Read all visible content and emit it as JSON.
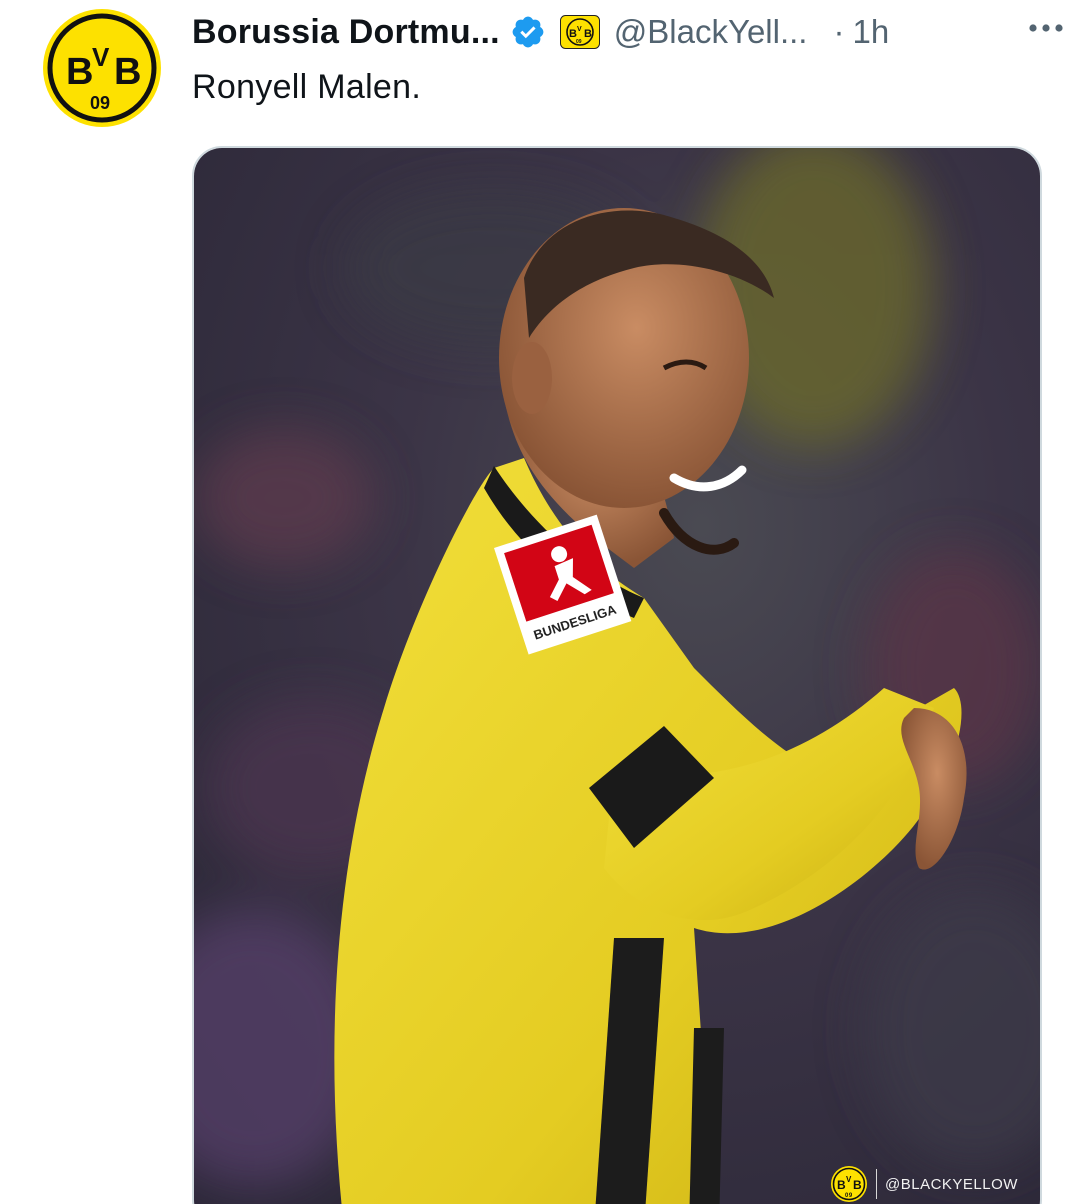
{
  "tweet": {
    "display_name": "Borussia Dortmu...",
    "handle": "@BlackYell...",
    "separator": "·",
    "time": "1h",
    "text": "Ronyell Malen."
  },
  "media": {
    "watermark": "@BLACKYELLOW",
    "patch_text": "BUNDESLIGA"
  },
  "icons": {
    "avatar": "bvb-crest-icon",
    "verified": "verified-badge-icon",
    "affiliation": "bvb-affiliation-icon",
    "more": "more-options-icon"
  },
  "colors": {
    "bvb_yellow": "#fde100",
    "verified_blue": "#1d9bf0",
    "text_primary": "#0f1419",
    "text_secondary": "#536471"
  }
}
